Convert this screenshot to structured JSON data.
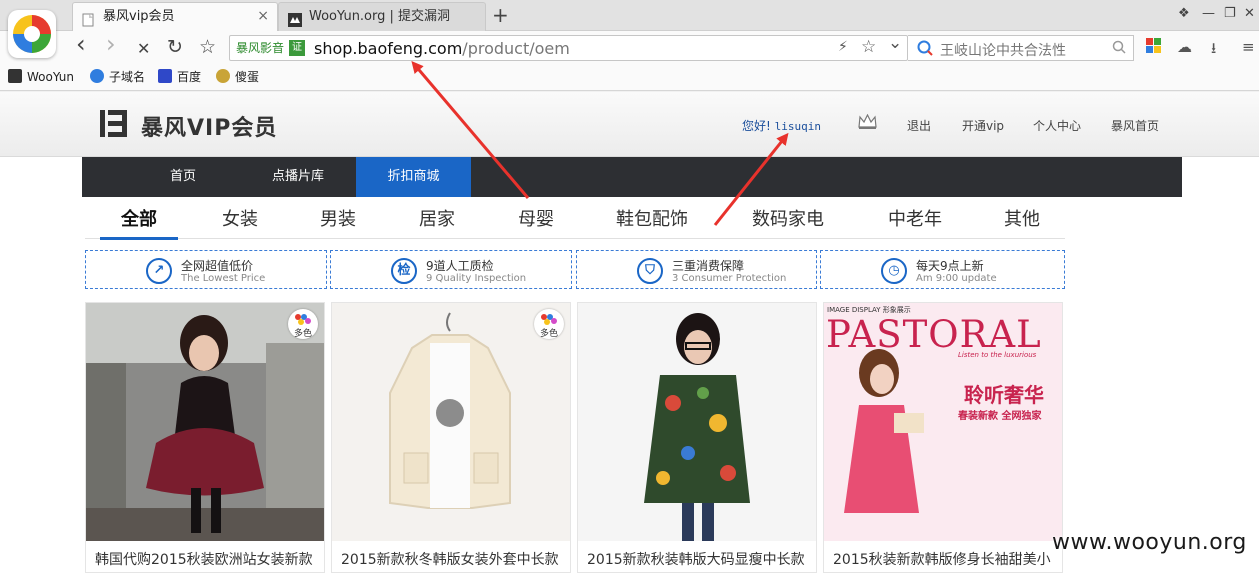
{
  "browser": {
    "tabs": [
      {
        "title": "暴风vip会员",
        "close": "×"
      },
      {
        "title": "WooYun.org | 提交漏洞"
      }
    ],
    "new_tab": "+",
    "window_controls": [
      "❖",
      "—",
      "❐",
      "✕"
    ],
    "nav": {
      "back": "‹",
      "forward": "›",
      "stop": "✕",
      "reload": "↻",
      "favorite": "☆"
    },
    "url": {
      "site_badge": "暴风影音",
      "verify": "证",
      "host": "shop.baofeng.com",
      "path": "/product/oem"
    },
    "search": {
      "placeholder": "王岐山论中共合法性",
      "dropdown": "⌄"
    },
    "bookmarks": [
      {
        "label": "WooYun",
        "icon": "wooyun-icon"
      },
      {
        "label": "子域名",
        "icon": "subdomain-icon"
      },
      {
        "label": "百度",
        "icon": "baidu-icon"
      },
      {
        "label": "傻蛋",
        "icon": "shadan-icon"
      }
    ]
  },
  "site": {
    "brand": "暴风VIP会员",
    "greeting": "您好!",
    "username": "lisuqin",
    "header_links": [
      "退出",
      "开通vip",
      "个人中心",
      "暴风首页"
    ],
    "main_nav": [
      {
        "label": "首页"
      },
      {
        "label": "点播片库"
      },
      {
        "label": "折扣商城",
        "active": true
      }
    ],
    "categories": [
      "全部",
      "女装",
      "男装",
      "居家",
      "母婴",
      "鞋包配饰",
      "数码家电",
      "中老年",
      "其他"
    ],
    "active_category": "全部",
    "services": [
      {
        "title": "全网超值低价",
        "subtitle": "The Lowest Price",
        "icon": "price-icon"
      },
      {
        "title": "9道人工质检",
        "subtitle": "9 Quality Inspection",
        "icon": "check-icon"
      },
      {
        "title": "三重消费保障",
        "subtitle": "3  Consumer Protection",
        "icon": "shield-icon"
      },
      {
        "title": "每天9点上新",
        "subtitle": "Am 9:00 update",
        "icon": "clock-icon"
      }
    ],
    "products": [
      {
        "title": "韩国代购2015秋装欧洲站女装新款",
        "badge": "多色"
      },
      {
        "title": "2015新款秋冬韩版女装外套中长款",
        "badge": "多色"
      },
      {
        "title": "2015新款秋装韩版大码显瘦中长款"
      },
      {
        "title": "2015秋装新款韩版修身长袖甜美小",
        "magazine": {
          "header": "IMAGE DISPLAY 形象展示",
          "title": "PASTORAL",
          "tagline": "Listen to the luxurious",
          "headline": "聆听奢华",
          "sub": "春装新款 全网独家"
        }
      }
    ]
  },
  "watermark": "www.wooyun.org",
  "colors": {
    "accent": "#1a66c6",
    "nav_bg": "#2d2f33",
    "arrow": "#e8322c"
  }
}
